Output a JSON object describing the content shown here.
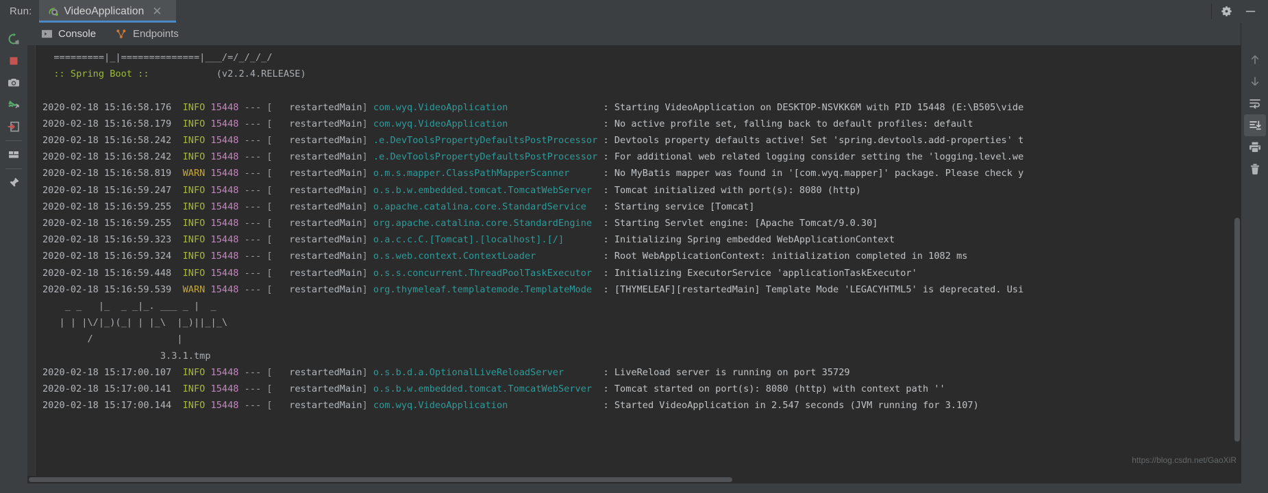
{
  "titlebar": {
    "run_label": "Run:",
    "tab_title": "VideoApplication",
    "tab_icon": "spring-boot-leaf-icon",
    "close_icon": "close-icon",
    "settings_icon": "gear-icon",
    "minimize_icon": "minimize-icon"
  },
  "tabs": [
    {
      "label": "Console",
      "icon": "console-icon",
      "selected": true
    },
    {
      "label": "Endpoints",
      "icon": "endpoints-icon",
      "selected": false
    }
  ],
  "toolbar_left": [
    {
      "name": "rerun-button",
      "icon": "rerun-icon",
      "color": "#59a869"
    },
    {
      "name": "stop-button",
      "icon": "stop-square-icon",
      "color": "#c75450"
    },
    {
      "name": "screenshot-button",
      "icon": "camera-icon",
      "color": "#afb1b3"
    },
    {
      "name": "thread-dump-button",
      "icon": "threads-icon",
      "color": "#59a869"
    },
    {
      "name": "attach-button",
      "icon": "arrow-into-box-icon",
      "color": "#c75450"
    },
    {
      "name": "layout-button",
      "icon": "layout-icon",
      "color": "#afb1b3"
    },
    {
      "name": "pin-tab-button",
      "icon": "pin-icon",
      "color": "#afb1b3"
    }
  ],
  "toolbar_right": [
    {
      "name": "up-button",
      "icon": "arrow-up-icon",
      "active": false
    },
    {
      "name": "down-button",
      "icon": "arrow-down-icon",
      "active": false
    },
    {
      "name": "soft-wrap-button",
      "icon": "soft-wrap-icon",
      "active": false
    },
    {
      "name": "scroll-to-end-button",
      "icon": "scroll-to-end-icon",
      "active": true
    },
    {
      "name": "print-button",
      "icon": "printer-icon",
      "active": false
    },
    {
      "name": "clear-all-button",
      "icon": "trash-icon",
      "active": false
    }
  ],
  "colors": {
    "accent": "#4a88c7",
    "info": "#a9b83c",
    "warn": "#c5a73b",
    "pid": "#c586c0",
    "logger": "#2e9a9a",
    "console_bg": "#2b2b2b",
    "panel_bg": "#3c3f41"
  },
  "watermark": "https://blog.csdn.net/GaoXiR",
  "console": {
    "banner": [
      {
        "type": "ascii",
        "text": "  =========|_|==============|___/=/_/_/_/"
      },
      {
        "type": "springboot",
        "name": ":: Spring Boot ::",
        "version": "(v2.2.4.RELEASE)"
      },
      {
        "type": "blank",
        "text": ""
      }
    ],
    "lines": [
      {
        "ts": "2020-02-18 15:16:58.176",
        "level": "INFO",
        "pid": "15448",
        "thread": "restartedMain",
        "logger": "com.wyq.VideoApplication",
        "msg": "Starting VideoApplication on DESKTOP-NSVKK6M with PID 15448 (E:\\B505\\vide"
      },
      {
        "ts": "2020-02-18 15:16:58.179",
        "level": "INFO",
        "pid": "15448",
        "thread": "restartedMain",
        "logger": "com.wyq.VideoApplication",
        "msg": "No active profile set, falling back to default profiles: default"
      },
      {
        "ts": "2020-02-18 15:16:58.242",
        "level": "INFO",
        "pid": "15448",
        "thread": "restartedMain",
        "logger": ".e.DevToolsPropertyDefaultsPostProcessor",
        "msg": "Devtools property defaults active! Set 'spring.devtools.add-properties' t"
      },
      {
        "ts": "2020-02-18 15:16:58.242",
        "level": "INFO",
        "pid": "15448",
        "thread": "restartedMain",
        "logger": ".e.DevToolsPropertyDefaultsPostProcessor",
        "msg": "For additional web related logging consider setting the 'logging.level.we"
      },
      {
        "ts": "2020-02-18 15:16:58.819",
        "level": "WARN",
        "pid": "15448",
        "thread": "restartedMain",
        "logger": "o.m.s.mapper.ClassPathMapperScanner",
        "msg": "No MyBatis mapper was found in '[com.wyq.mapper]' package. Please check y"
      },
      {
        "ts": "2020-02-18 15:16:59.247",
        "level": "INFO",
        "pid": "15448",
        "thread": "restartedMain",
        "logger": "o.s.b.w.embedded.tomcat.TomcatWebServer",
        "msg": "Tomcat initialized with port(s): 8080 (http)"
      },
      {
        "ts": "2020-02-18 15:16:59.255",
        "level": "INFO",
        "pid": "15448",
        "thread": "restartedMain",
        "logger": "o.apache.catalina.core.StandardService",
        "msg": "Starting service [Tomcat]"
      },
      {
        "ts": "2020-02-18 15:16:59.255",
        "level": "INFO",
        "pid": "15448",
        "thread": "restartedMain",
        "logger": "org.apache.catalina.core.StandardEngine",
        "msg": "Starting Servlet engine: [Apache Tomcat/9.0.30]"
      },
      {
        "ts": "2020-02-18 15:16:59.323",
        "level": "INFO",
        "pid": "15448",
        "thread": "restartedMain",
        "logger": "o.a.c.c.C.[Tomcat].[localhost].[/]",
        "msg": "Initializing Spring embedded WebApplicationContext"
      },
      {
        "ts": "2020-02-18 15:16:59.324",
        "level": "INFO",
        "pid": "15448",
        "thread": "restartedMain",
        "logger": "o.s.web.context.ContextLoader",
        "msg": "Root WebApplicationContext: initialization completed in 1082 ms"
      },
      {
        "ts": "2020-02-18 15:16:59.448",
        "level": "INFO",
        "pid": "15448",
        "thread": "restartedMain",
        "logger": "o.s.s.concurrent.ThreadPoolTaskExecutor",
        "msg": "Initializing ExecutorService 'applicationTaskExecutor'"
      },
      {
        "ts": "2020-02-18 15:16:59.539",
        "level": "WARN",
        "pid": "15448",
        "thread": "restartedMain",
        "logger": "org.thymeleaf.templatemode.TemplateMode",
        "msg": "[THYMELEAF][restartedMain] Template Mode 'LEGACYHTML5' is deprecated. Usi"
      }
    ],
    "mybatis_banner": [
      "    _ _   |_  _ _|_. ___ _ |  _",
      "   | | |\\/|_)(_| | |_\\  |_)||_|_\\",
      "        /               |",
      "                     3.3.1.tmp"
    ],
    "lines_tail": [
      {
        "ts": "2020-02-18 15:17:00.107",
        "level": "INFO",
        "pid": "15448",
        "thread": "restartedMain",
        "logger": "o.s.b.d.a.OptionalLiveReloadServer",
        "msg": "LiveReload server is running on port 35729"
      },
      {
        "ts": "2020-02-18 15:17:00.141",
        "level": "INFO",
        "pid": "15448",
        "thread": "restartedMain",
        "logger": "o.s.b.w.embedded.tomcat.TomcatWebServer",
        "msg": "Tomcat started on port(s): 8080 (http) with context path ''"
      },
      {
        "ts": "2020-02-18 15:17:00.144",
        "level": "INFO",
        "pid": "15448",
        "thread": "restartedMain",
        "logger": "com.wyq.VideoApplication",
        "msg": "Started VideoApplication in 2.547 seconds (JVM running for 3.107)"
      }
    ]
  }
}
